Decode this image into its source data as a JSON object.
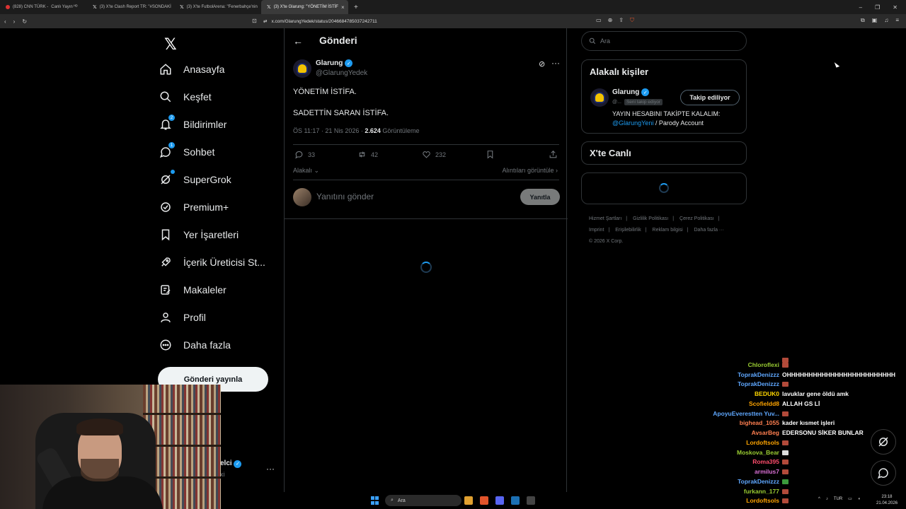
{
  "browser": {
    "tabs": [
      {
        "title": "(828) CNN TÜRK - ",
        "extra": "Canlı Yayın ᴴᴰ",
        "active": false
      },
      {
        "title": "(3) X'te Clash Report TR: \"#SONDAKİ",
        "extra": "",
        "active": false
      },
      {
        "title": "(3) X'te FutbolArena: \"Fenerbahçe'nin",
        "extra": "",
        "active": false
      },
      {
        "title": "(3) X'te Glarung: \"YÖNETİM İSTİF",
        "extra": "",
        "active": true
      }
    ],
    "url": "x.com/GlarungYedek/status/2046684785037242711"
  },
  "sidebar": {
    "items": [
      {
        "label": "Anasayfa",
        "icon": "home-icon"
      },
      {
        "label": "Keşfet",
        "icon": "search-icon"
      },
      {
        "label": "Bildirimler",
        "icon": "bell-icon",
        "badge": "2"
      },
      {
        "label": "Sohbet",
        "icon": "chat-icon",
        "badge": "1"
      },
      {
        "label": "SuperGrok",
        "icon": "grok-icon"
      },
      {
        "label": "Premium+",
        "icon": "premium-icon"
      },
      {
        "label": "Yer İşaretleri",
        "icon": "bookmark-icon"
      },
      {
        "label": "İçerik Üreticisi St...",
        "icon": "rocket-icon"
      },
      {
        "label": "Makaleler",
        "icon": "article-icon"
      },
      {
        "label": "Profil",
        "icon": "profile-icon"
      },
      {
        "label": "Daha fazla",
        "icon": "more-circle-icon"
      }
    ],
    "post_button": "Gönderi yayınla",
    "account_name": "elci",
    "account_handle": "xi"
  },
  "main": {
    "title": "Gönderi",
    "post": {
      "name": "Glarung",
      "handle": "@GlarungYedek",
      "text1": "YÖNETİM İSTİFA.",
      "text2": "SADETTİN SARAN İSTİFA.",
      "time": "ÖS 11:17 · 21 Nis 2026 · ",
      "views": "2.624",
      "views_label": " Görüntüleme",
      "replies": "33",
      "reposts": "42",
      "likes": "232"
    },
    "relevant": "Alakalı",
    "quotes": "Alıntıları görüntüle",
    "reply_placeholder": "Yanıtını gönder",
    "reply_button": "Yanıtla"
  },
  "right": {
    "search_placeholder": "Ara",
    "relevant_title": "Alakalı kişiler",
    "person": {
      "name": "Glarung",
      "handle": "@...",
      "follows_you": "Seni takip ediyor",
      "follow_button": "Takip ediliyor",
      "bio_prefix": "YAYIN HESABINI TAKİPTE KALALIM: ",
      "bio_link": "@GlarungYeni",
      "bio_suffix": " / Parody Account"
    },
    "live_title": "X'te Canlı",
    "footer": [
      "Hizmet Şartları",
      "|",
      "Gizlilik Politikası",
      "|",
      "Çerez Politikası",
      "|",
      "Imprint",
      "|",
      "Erişilebilirlik",
      "|",
      "Reklam bilgisi",
      "|",
      "Daha fazla ···",
      "© 2026 X Corp."
    ]
  },
  "chat": [
    {
      "user": "",
      "msg": "",
      "color": "#5fa8ff"
    },
    {
      "user": "Chloroflexi",
      "msg": "",
      "color": "#9acd32"
    },
    {
      "user": "ToprakDenizzz",
      "msg": "OHHHHHHHHHHHHHHHHHHHHHHHHH",
      "color": "#5fa8ff"
    },
    {
      "user": "ToprakDenizzz",
      "msg": "",
      "color": "#5fa8ff"
    },
    {
      "user": "BEDUK0",
      "msg": "lavuklar gene öldü amk",
      "color": "#ffd700"
    },
    {
      "user": "Scofieldd8",
      "msg": "ALLAH GS Lİ",
      "color": "#ffa500"
    },
    {
      "user": "ApoyuEverestten Yuv...",
      "msg": "",
      "color": "#5fa8ff"
    },
    {
      "user": "bighead_1055",
      "msg": "kader kısmet işleri",
      "color": "#ff7f50"
    },
    {
      "user": "AvsarBeg",
      "msg": "EDERSONU SİKER BUNLAR",
      "color": "#ff7f50"
    },
    {
      "user": "Lordoftsols",
      "msg": "",
      "color": "#ffa500"
    },
    {
      "user": "Moskova_Bear",
      "msg": "",
      "color": "#9acd32"
    },
    {
      "user": "Roma395",
      "msg": "",
      "color": "#ff4d6d"
    },
    {
      "user": "armilus7",
      "msg": "",
      "color": "#da70d6"
    },
    {
      "user": "ToprakDenizzz",
      "msg": "",
      "color": "#5fa8ff"
    },
    {
      "user": "furkann_177",
      "msg": "",
      "color": "#9acd32"
    },
    {
      "user": "Lordoftsols",
      "msg": "",
      "color": "#ffa500"
    }
  ],
  "taskbar": {
    "search": "Ara",
    "lang": "TUR",
    "time": "23:18",
    "date": "21.04.2026"
  }
}
